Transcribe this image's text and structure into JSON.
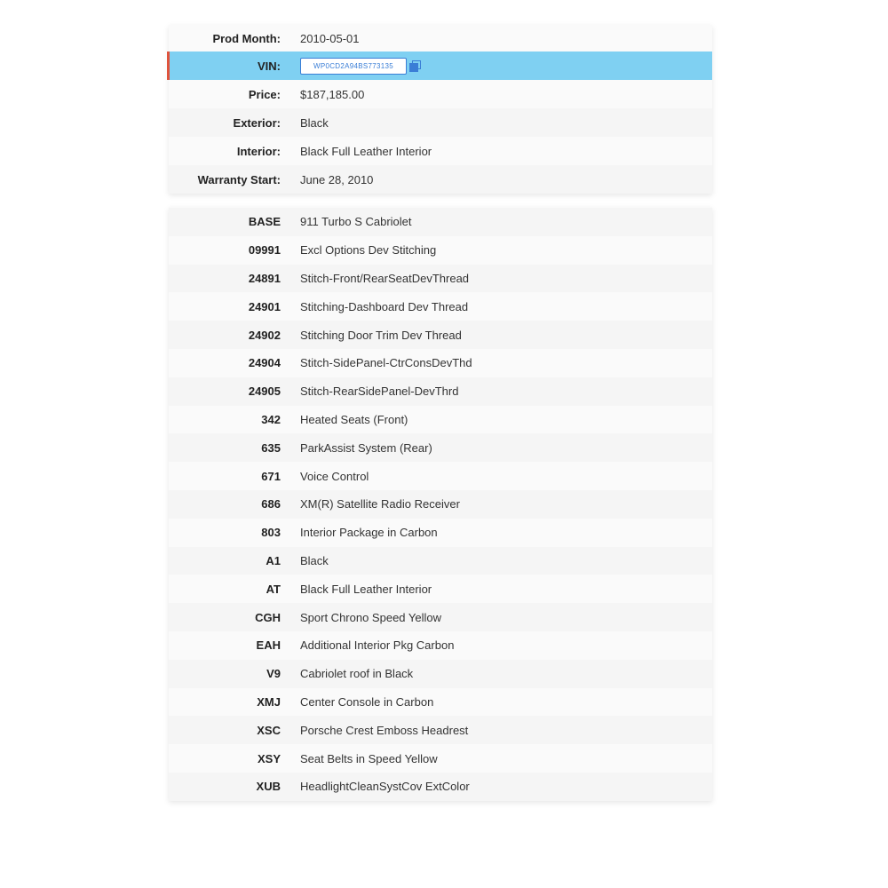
{
  "vehicle": {
    "prod_month_label": "Prod Month:",
    "prod_month": "2010-05-01",
    "vin_label": "VIN:",
    "vin": "WP0CD2A94BS773135",
    "price_label": "Price:",
    "price": "$187,185.00",
    "exterior_label": "Exterior:",
    "exterior": "Black",
    "interior_label": "Interior:",
    "interior": "Black Full Leather Interior",
    "warranty_label": "Warranty Start:",
    "warranty": "June 28, 2010"
  },
  "options": [
    {
      "code": "BASE",
      "desc": "911 Turbo S Cabriolet"
    },
    {
      "code": "09991",
      "desc": "Excl Options Dev Stitching"
    },
    {
      "code": "24891",
      "desc": "Stitch-Front/RearSeatDevThread"
    },
    {
      "code": "24901",
      "desc": "Stitching-Dashboard Dev Thread"
    },
    {
      "code": "24902",
      "desc": "Stitching Door Trim Dev Thread"
    },
    {
      "code": "24904",
      "desc": "Stitch-SidePanel-CtrConsDevThd"
    },
    {
      "code": "24905",
      "desc": "Stitch-RearSidePanel-DevThrd"
    },
    {
      "code": "342",
      "desc": "Heated Seats (Front)"
    },
    {
      "code": "635",
      "desc": "ParkAssist System (Rear)"
    },
    {
      "code": "671",
      "desc": "Voice Control"
    },
    {
      "code": "686",
      "desc": "XM(R) Satellite Radio Receiver"
    },
    {
      "code": "803",
      "desc": "Interior Package in Carbon"
    },
    {
      "code": "A1",
      "desc": "Black"
    },
    {
      "code": "AT",
      "desc": "Black Full Leather Interior"
    },
    {
      "code": "CGH",
      "desc": "Sport Chrono Speed Yellow"
    },
    {
      "code": "EAH",
      "desc": "Additional Interior Pkg Carbon"
    },
    {
      "code": "V9",
      "desc": "Cabriolet roof in Black"
    },
    {
      "code": "XMJ",
      "desc": "Center Console in Carbon"
    },
    {
      "code": "XSC",
      "desc": "Porsche Crest Emboss Headrest"
    },
    {
      "code": "XSY",
      "desc": "Seat Belts in Speed Yellow"
    },
    {
      "code": "XUB",
      "desc": "HeadlightCleanSystCov ExtColor"
    }
  ],
  "icons": {
    "copy": "copy-icon"
  },
  "colors": {
    "vin_highlight": "#7fd0f2",
    "vin_accent": "#e0533c",
    "link_blue": "#3a7ed6"
  }
}
